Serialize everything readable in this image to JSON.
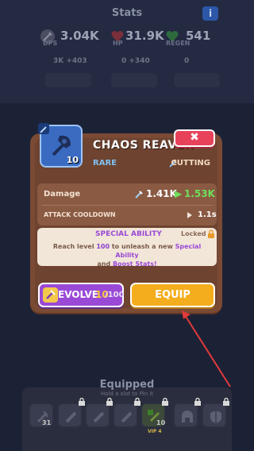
{
  "background": {
    "title": "Stats",
    "info_label": "i",
    "stats": [
      {
        "label": "DPS",
        "value": "3.04K",
        "icon": "sword-icon"
      },
      {
        "label": "HP",
        "value": "31.9K",
        "icon": "heart-icon"
      },
      {
        "label": "REGEN",
        "value": "541",
        "icon": "regen-heart-icon"
      }
    ],
    "sub_stats": [
      "3K +403",
      "0 +340",
      "0"
    ],
    "equipped_title": "Equipped",
    "equipped_hint": "Hold a slot to Pin it",
    "slots": [
      {
        "icon": "axe-icon",
        "level": "31"
      },
      {
        "icon": "sword-icon"
      },
      {
        "icon": "sword-icon"
      },
      {
        "icon": "sword-icon"
      },
      {
        "icon": "dagger-icon",
        "level": "10",
        "tag": "VIP 4"
      },
      {
        "icon": "helmet-icon"
      },
      {
        "icon": "shield-icon"
      }
    ]
  },
  "popup": {
    "item": {
      "name": "CHAOS REAVER",
      "level": "10",
      "rarity": "RARE",
      "type": "CUTTING",
      "icon": "axe-icon",
      "card_color": "#3a6bc1"
    },
    "close_label": "✖",
    "stats": {
      "damage_label": "Damage",
      "damage_current": "1.41K",
      "damage_arrow": "▶",
      "damage_next": "1.53K",
      "cooldown_label": "ATTACK COOLDOWN",
      "cooldown_value": "1.1s"
    },
    "special": {
      "title": "SPECIAL ABILITY",
      "status": "Locked",
      "desc_1": "Reach level ",
      "desc_level": "100",
      "desc_2": " to unleash a new ",
      "desc_special": "Special Ability",
      "desc_3": "and ",
      "desc_boost": "Boost Stats!"
    },
    "evolve": {
      "label": "EVOLVE",
      "count": "10",
      "max": "/100"
    },
    "equip_label": "EQUIP"
  },
  "colors": {
    "accent_purple": "#9a49d6",
    "accent_orange": "#f4ad1c",
    "close_red": "#e8425a",
    "upgrade_green": "#6fe05a",
    "annotation_arrow": "#e03a3a"
  }
}
